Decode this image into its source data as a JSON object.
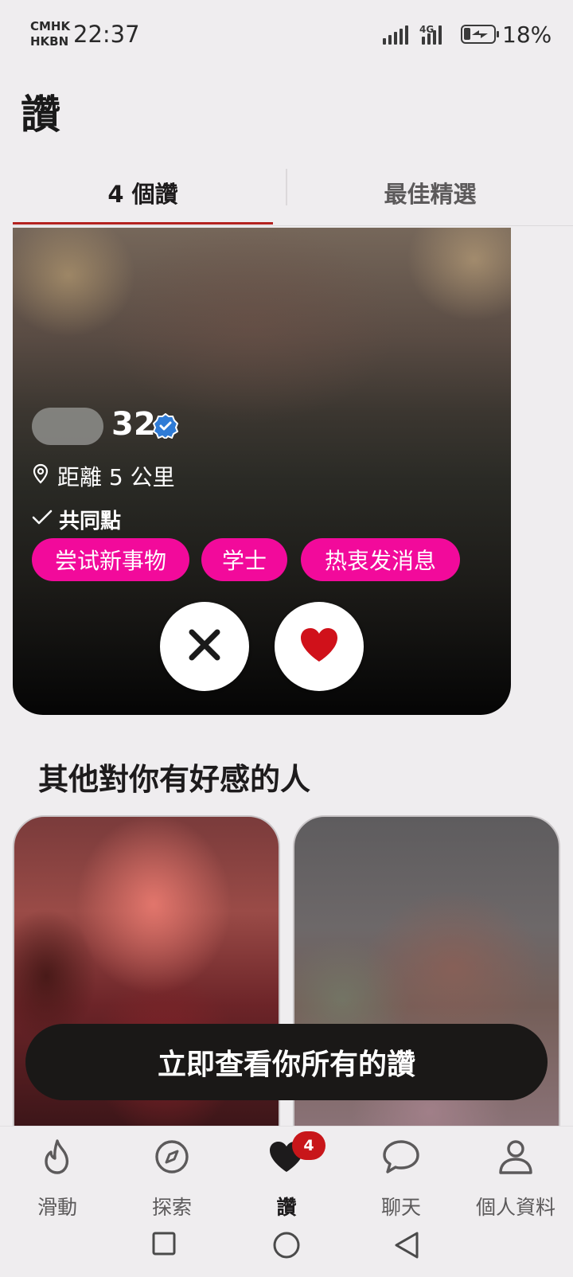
{
  "status_bar": {
    "carrier_line1": "CMHK",
    "carrier_line2": "HKBN",
    "time": "22:37",
    "network": "4G",
    "battery_percent": "18%",
    "battery_level": 0.18
  },
  "header": {
    "title": "讚"
  },
  "tabs": [
    {
      "label": "4 個讚",
      "active": true
    },
    {
      "label": "最佳精選",
      "active": false
    }
  ],
  "main_card": {
    "age": "32",
    "distance": "距離 5 公里",
    "common_label": "共同點",
    "interests": [
      "尝试新事物",
      "学士",
      "热衷发消息"
    ]
  },
  "section": {
    "title": "其他對你有好感的人"
  },
  "cta": {
    "label": "立即查看你所有的讚"
  },
  "bottom_nav": {
    "items": [
      {
        "label": "滑動",
        "icon": "flame-icon"
      },
      {
        "label": "探索",
        "icon": "compass-icon"
      },
      {
        "label": "讚",
        "icon": "heart-icon",
        "active": true,
        "badge": "4"
      },
      {
        "label": "聊天",
        "icon": "chat-bubble-icon"
      },
      {
        "label": "個人資料",
        "icon": "person-icon"
      }
    ]
  },
  "colors": {
    "accent_red": "#b3221f",
    "chip_pink": "#f20a9b",
    "badge_red": "#c8161a",
    "like_heart": "#d0111a",
    "verified_blue": "#2e7bd6"
  }
}
